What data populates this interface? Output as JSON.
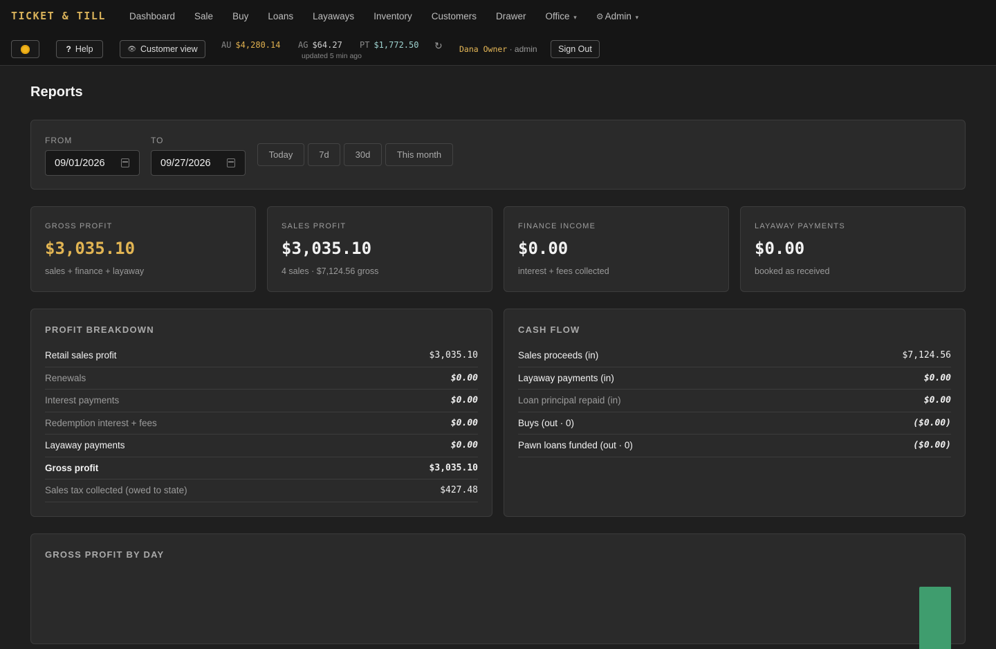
{
  "app": {
    "brand": "TICKET & TILL",
    "nav": [
      {
        "label": "Dashboard"
      },
      {
        "label": "Sale"
      },
      {
        "label": "Buy"
      },
      {
        "label": "Loans"
      },
      {
        "label": "Layaways"
      },
      {
        "label": "Inventory"
      },
      {
        "label": "Customers"
      },
      {
        "label": "Drawer"
      },
      {
        "label": "Office",
        "caret": "▾"
      },
      {
        "label": "Admin",
        "caret": "▾",
        "icon": "gear-icon"
      }
    ],
    "help_label": "Help",
    "help_glyph": "?",
    "customer_view_label": "Customer view",
    "metals": {
      "au": {
        "symbol": "AU",
        "value": "$4,280.14"
      },
      "ag": {
        "symbol": "AG",
        "value": "$64.27"
      },
      "pt": {
        "symbol": "PT",
        "value": "$1,772.50"
      }
    },
    "updated_text": "updated 5 min ago",
    "refresh_glyph": "↻",
    "user": {
      "name": "Dana Owner",
      "role": "· admin"
    },
    "sign_out_label": "Sign Out"
  },
  "page": {
    "title": "Reports",
    "filters": {
      "from_label": "FROM",
      "from_value": "09/01/2026",
      "to_label": "TO",
      "to_value": "09/27/2026",
      "ranges": [
        "Today",
        "7d",
        "30d",
        "This month"
      ]
    },
    "kpis": [
      {
        "label": "GROSS PROFIT",
        "value": "$3,035.10",
        "sub": "sales + finance + layaway",
        "accent": "#e2b553"
      },
      {
        "label": "SALES PROFIT",
        "value": "$3,035.10",
        "sub": "4 sales · $7,124.56 gross"
      },
      {
        "label": "FINANCE INCOME",
        "value": "$0.00",
        "sub": "interest + fees collected"
      },
      {
        "label": "LAYAWAY PAYMENTS",
        "value": "$0.00",
        "sub": "booked as received"
      }
    ],
    "profit_breakdown": {
      "title": "PROFIT BREAKDOWN",
      "rows": [
        {
          "label": "Retail sales profit",
          "value": "$3,035.10"
        },
        {
          "label": "Renewals",
          "value": "$0.00"
        },
        {
          "label": "Interest payments",
          "value": "$0.00"
        },
        {
          "label": "Redemption interest + fees",
          "value": "$0.00"
        },
        {
          "label": "Layaway payments",
          "value": "$0.00"
        },
        {
          "label": "Gross profit",
          "value": "$3,035.10"
        },
        {
          "label": "Sales tax collected (owed to state)",
          "value": "$427.48"
        }
      ]
    },
    "cash_flow": {
      "title": "CASH FLOW",
      "rows": [
        {
          "label": "Sales proceeds (in)",
          "value": "$7,124.56"
        },
        {
          "label": "Layaway payments (in)",
          "value": "$0.00"
        },
        {
          "label": "Loan principal repaid (in)",
          "value": "$0.00"
        },
        {
          "label": "Buys (out · 0)",
          "value": "($0.00)"
        },
        {
          "label": "Pawn loans funded (out · 0)",
          "value": "($0.00)"
        }
      ]
    },
    "gross_profit_by_day": {
      "title": "GROSS PROFIT BY DAY"
    }
  },
  "colors": {
    "accent_gold": "#e2b553",
    "bar_green": "#3f9d6e",
    "background": "#1f1f1f",
    "card": "#2a2a2a"
  }
}
